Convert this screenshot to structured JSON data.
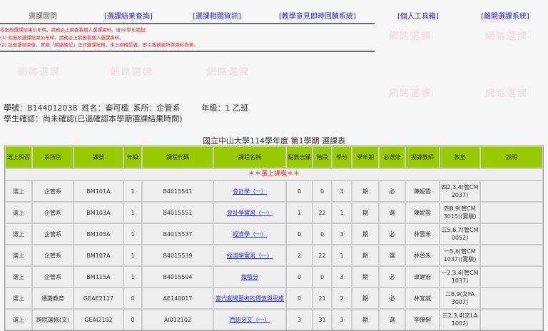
{
  "nav": {
    "closed": "選課關閉",
    "links": [
      "[選課結果查詢]",
      "[選課相關資訊]",
      "[教學意見即時回饋系統]",
      "[個人工具箱]",
      "[離開選課系統]"
    ]
  },
  "notice": [
    "各階段選課結果公布時，請務必上網查看個人選課資料。自92學年度起：",
    "(1) 各階段選課結果公布時，請務必上網查看個人選課資料。",
    "(2) 加退選結束後，實施「網路確認」正式選課紀錄，未上網確認者，即以教務處所存資料為準。"
  ],
  "student": {
    "id": "學號：B144012038",
    "name": "姓名：秦可楹",
    "dept": "系所：企管系",
    "grade": "年級：1 乙班",
    "confirm": "學生確認：尚未確認(已過確認本學期選課結果時間)"
  },
  "table_title": "國立中山大學114學年度 第1學期 選課表",
  "headers": [
    "選上與否",
    "系所別",
    "課號",
    "年級",
    "課程代碼",
    "課程名稱",
    "點數志願",
    "階段",
    "學分",
    "學年期",
    "必選修",
    "授課教師",
    "教室",
    "說明"
  ],
  "section": "＊＊選上課程＊＊",
  "rows": [
    [
      "選上",
      "企管系",
      "BM101A",
      "1",
      "B4015541",
      "會計學（一）",
      "0",
      "0",
      "3",
      "期",
      "必",
      "陳妮雲",
      "四2,3,4(管CM 2037)",
      ""
    ],
    [
      "選上",
      "企管系",
      "BM103A",
      "1",
      "B4015551",
      "會計學實習（一）",
      "1",
      "22",
      "1",
      "期",
      "選",
      "陳妮雲",
      "四8,9(管CM 3015)(實驗)",
      ""
    ],
    [
      "選上",
      "企管系",
      "BM105A",
      "1",
      "B4015537",
      "經濟學（一）",
      "0",
      "0",
      "3",
      "期",
      "必",
      "林晉禾",
      "三5,6,7(管CM 0052)",
      ""
    ],
    [
      "選上",
      "企管系",
      "BM107A",
      "1",
      "B4015539",
      "經濟學實習（一）",
      "2",
      "22",
      "1",
      "期",
      "選",
      "林晉禾",
      "一5,6(管CM 1037)(實驗)",
      ""
    ],
    [
      "選上",
      "企管系",
      "BM115A",
      "1",
      "B4015594",
      "微積分",
      "0",
      "0",
      "3",
      "期",
      "必",
      "卓建宏",
      "一2,3,4(管CM 1037)",
      ""
    ],
    [
      "選上",
      "通識教育",
      "GEAE2117",
      "0",
      "AE140017",
      "當代劇場藝術的價值與思維",
      "0",
      "21",
      "2",
      "期",
      "必",
      "林宜誠",
      "二8,9(文FA 3007)",
      ""
    ],
    [
      "選上",
      "跨院選修(文)",
      "GEAI2102",
      "0",
      "AI012102",
      "西班牙文（一）",
      "3",
      "31",
      "3",
      "期",
      "選",
      "李優俐",
      "三2,3,4(文LA 1002)",
      ""
    ]
  ]
}
